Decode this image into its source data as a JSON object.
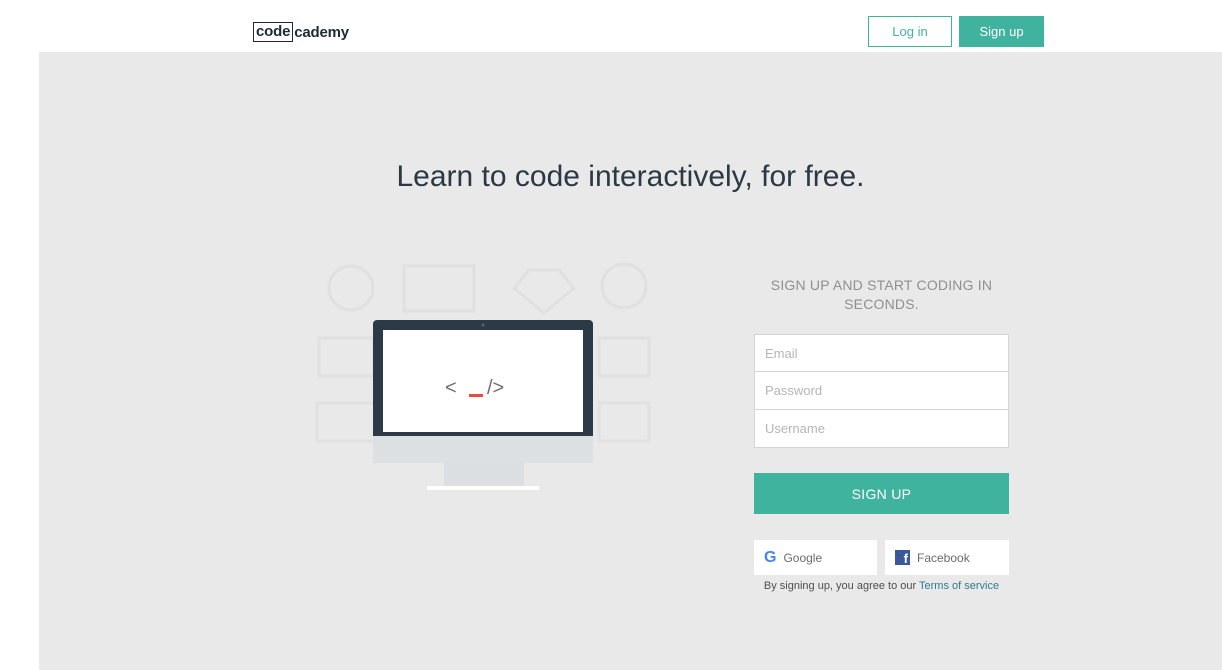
{
  "header": {
    "logo_box": "code",
    "logo_rest": "cademy",
    "login_label": "Log in",
    "signup_label": "Sign up"
  },
  "hero": {
    "title": "Learn to code interactively, for free."
  },
  "illustration": {
    "code_open": "<",
    "code_close": "/>"
  },
  "signup": {
    "title_line1": "SIGN UP AND START CODING IN",
    "title_line2": "SECONDS.",
    "email_placeholder": "Email",
    "password_placeholder": "Password",
    "username_placeholder": "Username",
    "submit_label": "SIGN UP",
    "google_label": "Google",
    "facebook_label": "Facebook",
    "terms_prefix": "By signing up, you agree to our ",
    "terms_link": "Terms of service"
  },
  "colors": {
    "accent": "#3fb39e",
    "dark_text": "#2b3845",
    "background": "#e9e9e9",
    "cursor_red": "#e74c3c"
  },
  "icons": {
    "google": "google-icon",
    "facebook": "facebook-icon"
  }
}
